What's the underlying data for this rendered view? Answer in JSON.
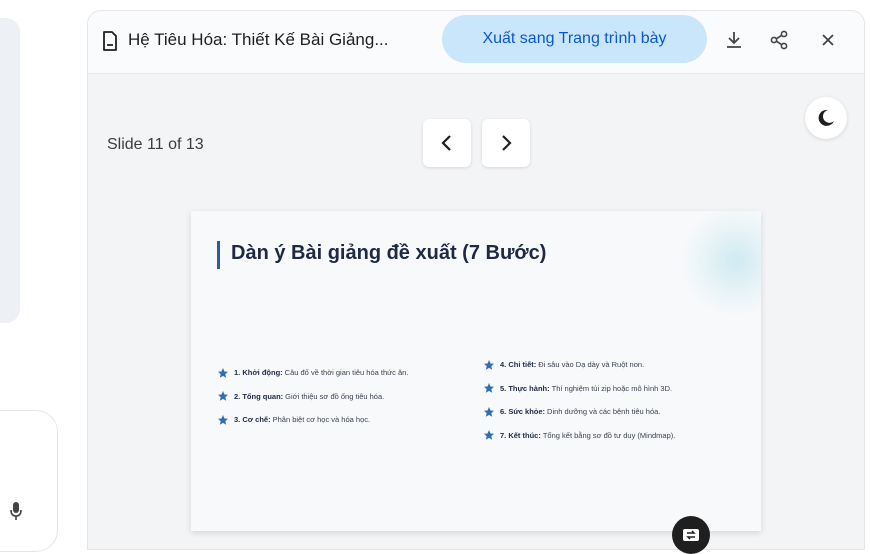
{
  "header": {
    "title": "Hệ Tiêu Hóa: Thiết Kế Bài Giảng...",
    "export_label": "Xuất sang Trang trình bày"
  },
  "viewer": {
    "slide_counter": "Slide 11 of 13"
  },
  "slide": {
    "title": "Dàn ý Bài giảng đề xuất (7 Bước)",
    "left_items": [
      {
        "label": "1. Khởi động:",
        "text": "Câu đố về thời gian tiêu hóa thức ăn."
      },
      {
        "label": "2. Tổng quan:",
        "text": "Giới thiệu sơ đồ ống tiêu hóa."
      },
      {
        "label": "3. Cơ chế:",
        "text": "Phân biệt cơ học và hóa học."
      }
    ],
    "right_items": [
      {
        "label": "4. Chi tiết:",
        "text": "Đi sâu vào Dạ dày và Ruột non."
      },
      {
        "label": "5. Thực hành:",
        "text": "Thí nghiệm túi zip hoặc mô hình 3D."
      },
      {
        "label": "6. Sức khỏe:",
        "text": "Dinh dưỡng và các bệnh tiêu hóa."
      },
      {
        "label": "7. Kết thúc:",
        "text": "Tổng kết bằng sơ đồ tư duy (Mindmap)."
      }
    ]
  },
  "icons": {
    "document": "document-icon",
    "download": "download-icon",
    "share": "share-icon",
    "close": "close-icon",
    "theme": "moon-icon",
    "prev": "chevron-left-icon",
    "next": "chevron-right-icon",
    "bullet": "star-icon",
    "mic": "mic-icon"
  },
  "colors": {
    "accent": "#0b57d0",
    "export_bg": "#c9e6fb",
    "star": "#2f6db5",
    "title_bar": "#2f5aa8"
  }
}
